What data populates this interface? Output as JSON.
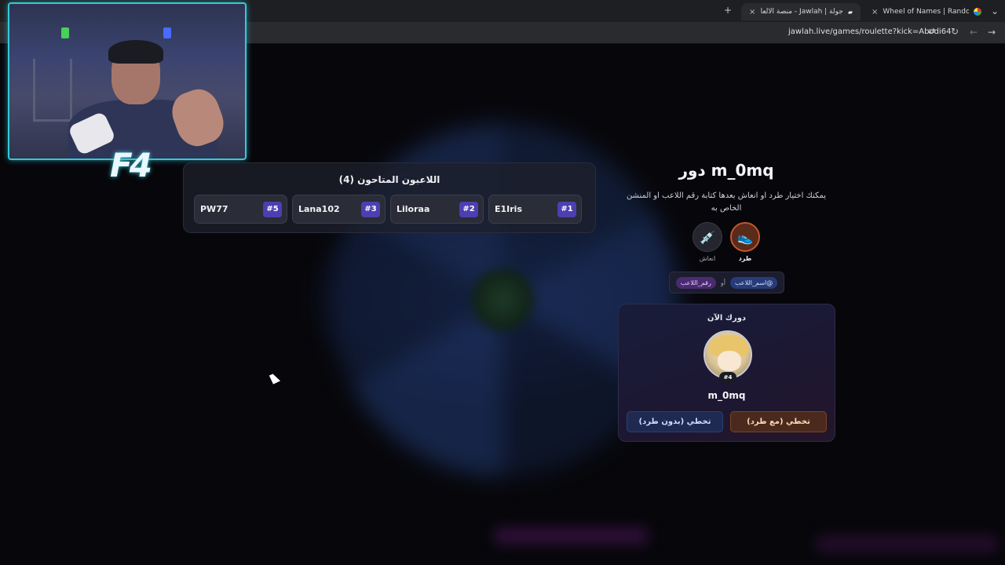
{
  "browser": {
    "tabs": [
      {
        "label": "Wheel of Names | Random nam",
        "favicon": "wheel-favicon"
      },
      {
        "label": "جولة | Jawlah - منصة الألعاب الت",
        "favicon": "jawlah-favicon",
        "active": true
      }
    ],
    "new_tab_label": "+",
    "url": "jawlah.live/games/roulette?kick=Abodi64"
  },
  "overlay": {
    "logo_text": "F4"
  },
  "players_panel": {
    "title": "اللاعبون المتاحون (4)",
    "players": [
      {
        "name": "E1Iris",
        "rank": "#1"
      },
      {
        "name": "Liloraa",
        "rank": "#2"
      },
      {
        "name": "Lana102",
        "rank": "#3"
      },
      {
        "name": "PW77",
        "rank": "#5"
      }
    ]
  },
  "turn": {
    "title": "دور m_0mq",
    "help_text": "يمكنك اختيار طرد او انعاش بعدها كتابة رقم اللاعب او المنشن الخاص به",
    "actions": {
      "kick_label": "طرد",
      "revive_label": "انعاش"
    },
    "mention": {
      "name_chip": "@اسم_اللاعب",
      "or_label": "أو",
      "number_chip": "رقم_اللاعب"
    },
    "card": {
      "header": "دورك الآن",
      "player_name": "m_0mq",
      "player_rank": "#4",
      "skip_with_kick": "تخطي (مع طرد)",
      "skip_without_kick": "تخطي (بدون طرد)"
    }
  },
  "colors": {
    "accent_purple": "#4d3fb2",
    "webcam_frame": "#36c8d8",
    "kick_button": "#4a2a1c",
    "nokick_button": "#1f2a52"
  }
}
